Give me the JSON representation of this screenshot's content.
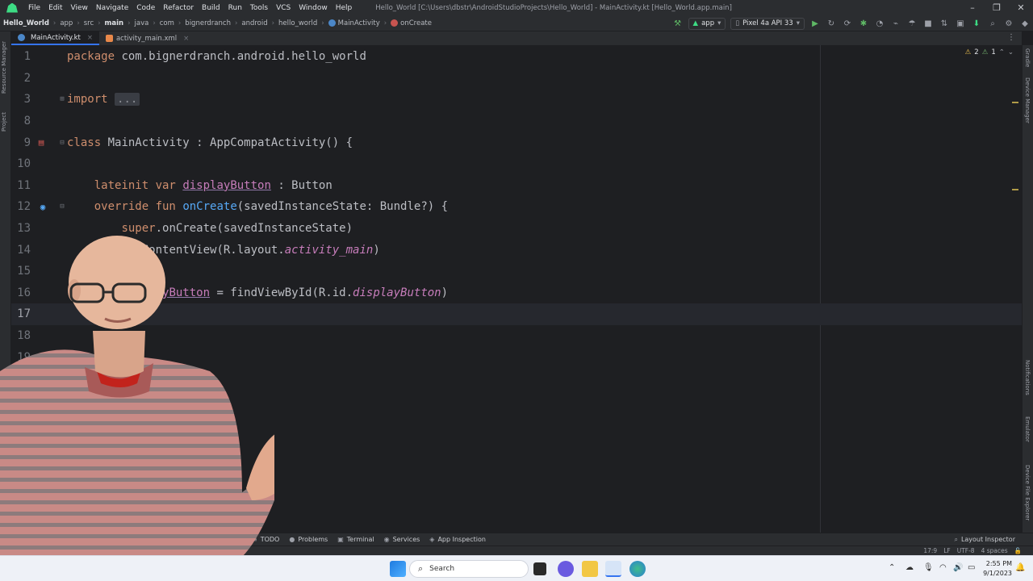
{
  "app": {
    "menu": [
      "File",
      "Edit",
      "View",
      "Navigate",
      "Code",
      "Refactor",
      "Build",
      "Run",
      "Tools",
      "VCS",
      "Window",
      "Help"
    ],
    "window_title": "Hello_World [C:\\Users\\dbstr\\AndroidStudioProjects\\Hello_World] - MainActivity.kt [Hello_World.app.main]"
  },
  "breadcrumb": [
    "Hello_World",
    "app",
    "src",
    "main",
    "java",
    "com",
    "bignerdranch",
    "android",
    "hello_world",
    "MainActivity",
    "onCreate"
  ],
  "toolbar": {
    "run_config": "app",
    "device": "Pixel 4a API 33"
  },
  "tabs": [
    {
      "label": "MainActivity.kt",
      "active": true
    },
    {
      "label": "activity_main.xml",
      "active": false
    }
  ],
  "left_strip": [
    "Resource Manager",
    "Project"
  ],
  "right_strip": [
    "Gradle",
    "Device Manager",
    "Notifications",
    "Emulator",
    "Device File Explorer"
  ],
  "inspection": {
    "warnings": "2",
    "weak_warnings": "1"
  },
  "editor": {
    "line_numbers": [
      "1",
      "2",
      "3",
      "8",
      "9",
      "10",
      "11",
      "12",
      "13",
      "14",
      "15",
      "16",
      "17",
      "18",
      "19"
    ],
    "lines": {
      "l1_kw": "package",
      "l1_rest": " com.bignerdranch.android.hello_world",
      "l3_kw": "import",
      "l3_fold": "...",
      "l9_kw": "class",
      "l9_rest": " MainActivity : AppCompatActivity() {",
      "l11_kw": "lateinit var",
      "l11_name": "displayButton",
      "l11_rest": " : Button",
      "l12_kw": "override fun",
      "l12_fn": "onCreate",
      "l12_rest": "(savedInstanceState: Bundle?) {",
      "l13_kw": "super",
      "l13_rest": ".onCreate(savedInstanceState)",
      "l14_rest": "setContentView(R.layout.",
      "l14_it": "activity_main",
      "l14_end": ")",
      "l16_name": "displayButton",
      "l16_rest": " = findViewById(R.id.",
      "l16_it": "displayButton",
      "l16_end": ")"
    }
  },
  "bottom_tools": [
    "TODO",
    "Problems",
    "Terminal",
    "Services",
    "App Inspection"
  ],
  "bottom_right_tool": "Layout Inspector",
  "status": {
    "position": "17:9",
    "line_sep": "LF",
    "encoding": "UTF-8",
    "indent": "4 spaces"
  },
  "taskbar": {
    "search_placeholder": "Search",
    "time": "2:55 PM",
    "date": "9/1/2023"
  },
  "colors": {
    "editor_bg": "#1e1f22",
    "keyword": "#cf8e6d",
    "function": "#56a8f5",
    "property": "#c77dbb",
    "accent": "#3574f0"
  }
}
